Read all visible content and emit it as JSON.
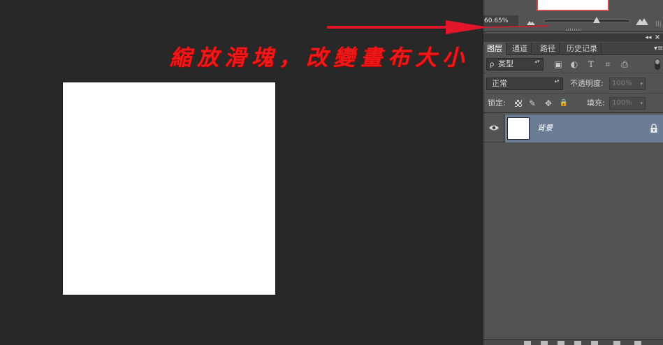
{
  "annotation": {
    "text": "縮放滑塊，改變畫布大小",
    "color": "#f01818"
  },
  "navigator": {
    "zoom_value": "60.65%",
    "zoom_fraction": 0.6065,
    "zoom_out_icon": "mountain-small-icon",
    "zoom_in_icon": "mountain-large-icon"
  },
  "panel_header": {
    "collapse_symbol": "◂◂",
    "close_symbol": "×"
  },
  "tabs": [
    {
      "label": "图层",
      "active": true
    },
    {
      "label": "通道",
      "active": false
    },
    {
      "label": "路径",
      "active": false
    },
    {
      "label": "历史记录",
      "active": false
    }
  ],
  "tabs_menu_symbol": "▾≡",
  "filter": {
    "search_symbol": "ρ",
    "label": "类型",
    "icons": [
      {
        "name": "image-filter-icon",
        "glyph": "▣"
      },
      {
        "name": "adjustment-filter-icon",
        "glyph": "◐"
      },
      {
        "name": "text-filter-icon",
        "glyph": "T"
      },
      {
        "name": "shape-filter-icon",
        "glyph": "⌗"
      },
      {
        "name": "smart-object-filter-icon",
        "glyph": "⎙"
      }
    ]
  },
  "blend": {
    "mode": "正常",
    "opacity_label": "不透明度:",
    "opacity_value": "100%"
  },
  "lock": {
    "label": "锁定:",
    "icons": [
      {
        "name": "lock-transparent-icon",
        "glyph": ""
      },
      {
        "name": "lock-paint-brush-icon",
        "glyph": "✎"
      },
      {
        "name": "lock-position-move-icon",
        "glyph": "✥"
      },
      {
        "name": "lock-all-icon",
        "glyph": "🔒"
      }
    ],
    "fill_label": "填充:",
    "fill_value": "100%"
  },
  "layers": [
    {
      "name": "背景",
      "visible": true,
      "locked": true
    }
  ],
  "updown_symbol": "▴▾",
  "dropdown_symbol": "▾",
  "colors": {
    "canvas_bg": "#282828",
    "panel_bg": "#535353",
    "selected_layer": "#6b7c94",
    "nav_frame": "#d24b4b"
  }
}
